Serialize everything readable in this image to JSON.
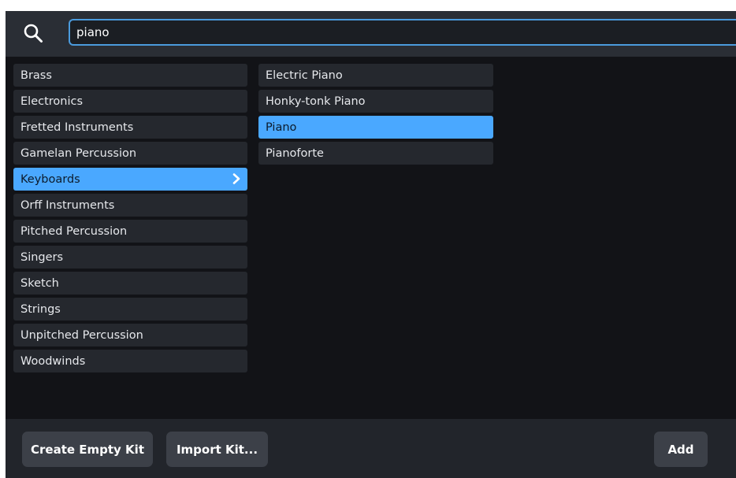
{
  "search": {
    "value": "piano",
    "icon": "search-icon"
  },
  "categories": [
    {
      "label": "Brass",
      "selected": false
    },
    {
      "label": "Electronics",
      "selected": false
    },
    {
      "label": "Fretted Instruments",
      "selected": false
    },
    {
      "label": "Gamelan Percussion",
      "selected": false
    },
    {
      "label": "Keyboards",
      "selected": true
    },
    {
      "label": "Orff Instruments",
      "selected": false
    },
    {
      "label": "Pitched Percussion",
      "selected": false
    },
    {
      "label": "Singers",
      "selected": false
    },
    {
      "label": "Sketch",
      "selected": false
    },
    {
      "label": "Strings",
      "selected": false
    },
    {
      "label": "Unpitched Percussion",
      "selected": false
    },
    {
      "label": "Woodwinds",
      "selected": false
    }
  ],
  "instruments": [
    {
      "label": "Electric Piano",
      "selected": false
    },
    {
      "label": "Honky-tonk Piano",
      "selected": false
    },
    {
      "label": "Piano",
      "selected": true
    },
    {
      "label": "Pianoforte",
      "selected": false
    }
  ],
  "footer": {
    "create_empty_kit_label": "Create Empty Kit",
    "import_kit_label": "Import Kit...",
    "add_label": "Add"
  },
  "colors": {
    "accent": "#4aa8ff",
    "focus_border": "#4b9bdd",
    "background": "#121317"
  }
}
